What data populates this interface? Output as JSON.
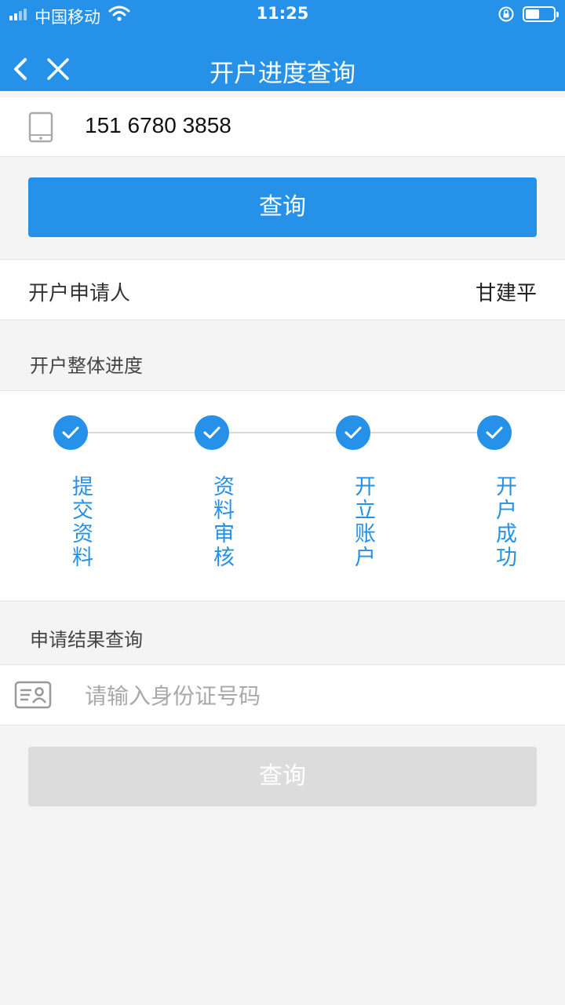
{
  "status_bar": {
    "carrier": "中国移动",
    "time": "11:25",
    "battery_level": 0.5
  },
  "nav": {
    "title": "开户进度查询"
  },
  "phone": {
    "value": "151 6780 3858"
  },
  "query_button": {
    "label": "查询"
  },
  "applicant": {
    "label": "开户申请人",
    "name": "甘建平"
  },
  "progress": {
    "section_label": "开户整体进度",
    "steps": [
      {
        "label": "提交资料",
        "done": true
      },
      {
        "label": "资料审核",
        "done": true
      },
      {
        "label": "开立账户",
        "done": true
      },
      {
        "label": "开户成功",
        "done": true
      }
    ]
  },
  "result": {
    "section_label": "申请结果查询",
    "id_placeholder": "请输入身份证号码",
    "button_label": "查询"
  },
  "colors": {
    "primary": "#2591e8",
    "disabled": "#dcdcdc",
    "background": "#f4f4f4"
  }
}
